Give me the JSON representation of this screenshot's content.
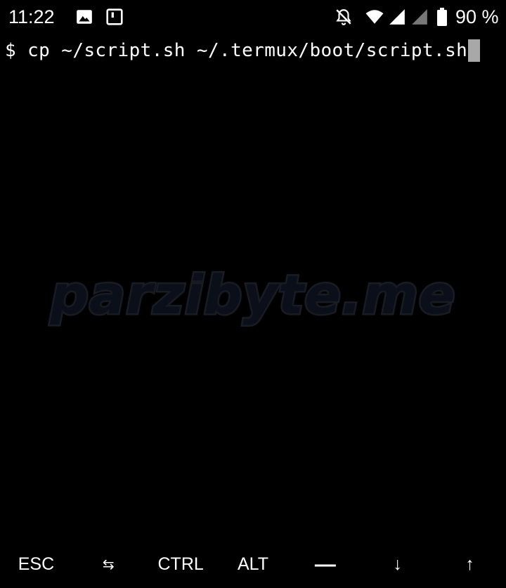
{
  "status_bar": {
    "time": "11:22",
    "battery_percent": "90 %",
    "icons": [
      "image-icon",
      "notification-box-icon",
      "bell-off-icon",
      "wifi-icon",
      "signal-icon",
      "signal-empty-icon",
      "battery-icon"
    ]
  },
  "terminal": {
    "command_line": "$ cp ~/script.sh ~/.termux/boot/script.sh",
    "watermark": "parzibyte.me",
    "colors": {
      "background": "#000000",
      "text": "#ffffff",
      "cursor": "#a8a8a8"
    }
  },
  "extra_keys": {
    "esc": "ESC",
    "tab": "⇆",
    "ctrl": "CTRL",
    "alt": "ALT",
    "dash": "—",
    "down": "↓",
    "up": "↑"
  }
}
